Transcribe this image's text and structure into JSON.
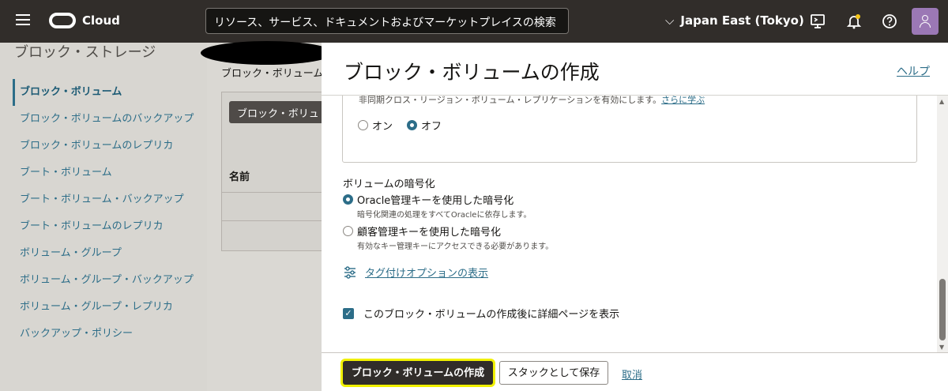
{
  "header": {
    "brand": "Cloud",
    "search_placeholder": "リソース、サービス、ドキュメントおよびマーケットプレイスの検索",
    "region": "Japan East (Tokyo)",
    "icons": [
      "menu-icon",
      "cloud-shell-icon",
      "notifications-icon",
      "help-icon",
      "profile-avatar"
    ]
  },
  "sidebar": {
    "title": "ブロック・ストレージ",
    "items": [
      {
        "label": "ブロック・ボリューム",
        "active": true
      },
      {
        "label": "ブロック・ボリュームのバックアップ"
      },
      {
        "label": "ブロック・ボリュームのレプリカ"
      },
      {
        "label": "ブート・ボリューム"
      },
      {
        "label": "ブート・ボリューム・バックアップ"
      },
      {
        "label": "ブート・ボリュームのレプリカ"
      },
      {
        "label": "ボリューム・グループ"
      },
      {
        "label": "ボリューム・グループ・バックアップ"
      },
      {
        "label": "ボリューム・グループ・レプリカ"
      },
      {
        "label": "バックアップ・ポリシー"
      }
    ]
  },
  "background": {
    "breadcrumb": "ブロック・ボリューム",
    "create_button": "ブロック・ボリュ",
    "name_column": "名前"
  },
  "drawer": {
    "title": "ブロック・ボリュームの作成",
    "help": "ヘルプ",
    "replication": {
      "description": "非同期クロス・リージョン・ボリューム・レプリケーションを有効にします。",
      "learn_more": "さらに学ぶ",
      "on_label": "オン",
      "off_label": "オフ",
      "selected": "off"
    },
    "encryption": {
      "label": "ボリュームの暗号化",
      "oracle_label": "Oracle管理キーを使用した暗号化",
      "oracle_desc": "暗号化関連の処理をすべてOracleに依存します。",
      "customer_label": "顧客管理キーを使用した暗号化",
      "customer_desc": "有効なキー管理キーにアクセスできる必要があります。",
      "selected": "oracle"
    },
    "tagging_link": "タグ付けオプションの表示",
    "view_details_checkbox": "このブロック・ボリュームの作成後に詳細ページを表示",
    "view_details_checked": true
  },
  "footer": {
    "create": "ブロック・ボリュームの作成",
    "save_stack": "スタックとして保存",
    "cancel": "取消"
  },
  "colors": {
    "header_bg": "#312d2a",
    "link": "#2c6d88",
    "highlight": "#f0f000"
  }
}
